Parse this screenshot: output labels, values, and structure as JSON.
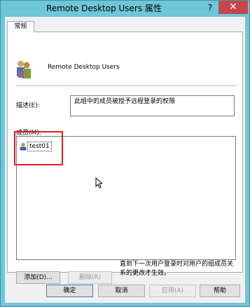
{
  "window": {
    "title": "Remote Desktop Users 属性",
    "help_glyph": "?",
    "close_glyph": "✕"
  },
  "tabs": [
    {
      "label": "常规",
      "active": true
    }
  ],
  "group": {
    "name": "Remote Desktop Users",
    "description_label": "描述(E):",
    "description": "此组中的成员被授予远程登录的权限",
    "members_label": "成员(M):",
    "members": [
      {
        "name": "test01",
        "selected": true
      }
    ]
  },
  "note": "直到下一次用户登录时对用户的组成员关系的更改才生效。",
  "buttons": {
    "add": "添加(D)...",
    "remove": "删除(R)",
    "ok": "确定",
    "cancel": "取消",
    "apply": "应用(A)",
    "help": "帮助"
  },
  "colors": {
    "title_bar": "#6fc6d8",
    "close_button": "#c6474a",
    "highlight": "#e02020"
  }
}
